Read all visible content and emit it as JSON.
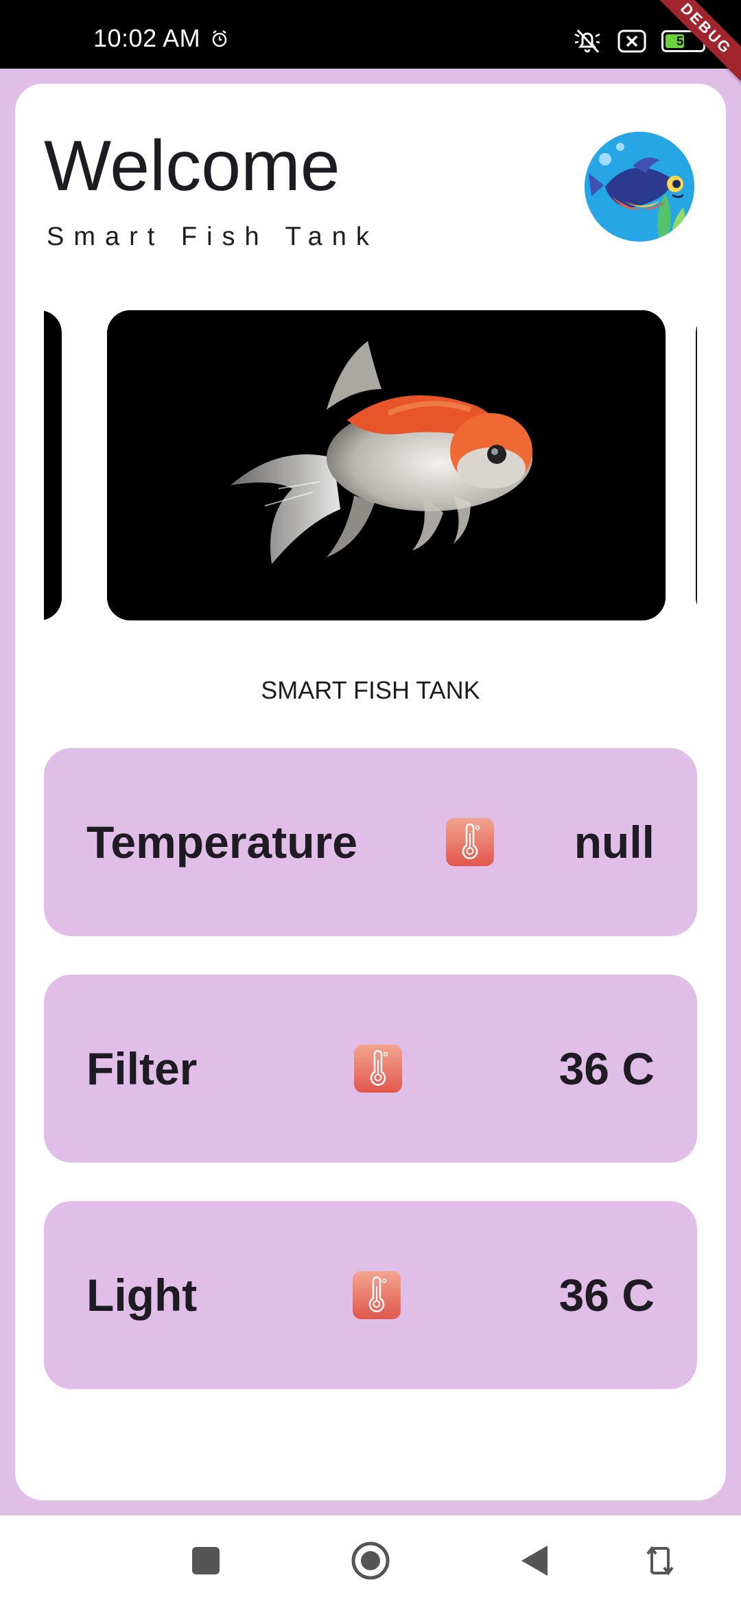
{
  "status_bar": {
    "time": "10:02 AM",
    "battery_level": "57",
    "battery_fraction": 0.57
  },
  "debug_banner": {
    "label": "DEBUG"
  },
  "header": {
    "title": "Welcome",
    "subtitle": "Smart Fish Tank"
  },
  "carousel": {
    "caption": "SMART FISH TANK",
    "slides": [
      "goldfish"
    ]
  },
  "sensors": [
    {
      "label": "Temperature",
      "value": "null",
      "icon": "thermometer-icon"
    },
    {
      "label": "Filter",
      "value": "36 C",
      "icon": "thermometer-icon"
    },
    {
      "label": "Light",
      "value": "36 C",
      "icon": "thermometer-icon"
    }
  ],
  "nav": {
    "buttons": [
      "recents-square-icon",
      "home-circle-icon",
      "back-triangle-icon",
      "rotate-icon"
    ]
  },
  "colors": {
    "accent_background": "#e1bee7",
    "card_background": "#ffffff",
    "text": "#1f1b23",
    "icon_gradient_top": "#f2a58f",
    "icon_gradient_bottom": "#e0574d",
    "debug_ribbon": "#a0252c"
  }
}
